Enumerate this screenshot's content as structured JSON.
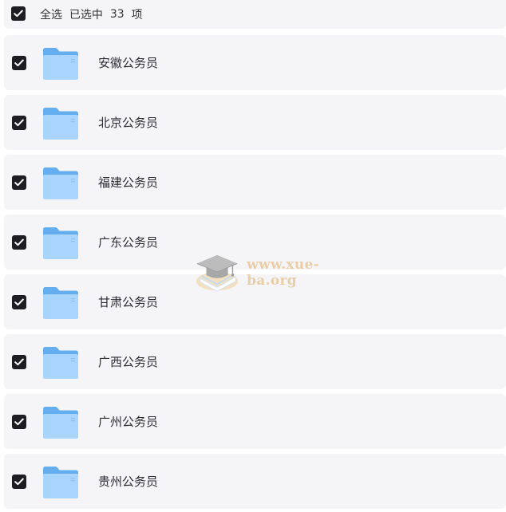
{
  "header": {
    "select_all_label": "全选",
    "selected_prefix": "已选中",
    "selected_count": "33",
    "selected_suffix": "项",
    "checked": true
  },
  "folders": [
    {
      "name": "安徽公务员",
      "checked": true
    },
    {
      "name": "北京公务员",
      "checked": true
    },
    {
      "name": "福建公务员",
      "checked": true
    },
    {
      "name": "广东公务员",
      "checked": true
    },
    {
      "name": "甘肃公务员",
      "checked": true
    },
    {
      "name": "广西公务员",
      "checked": true
    },
    {
      "name": "广州公务员",
      "checked": true
    },
    {
      "name": "贵州公务员",
      "checked": true
    }
  ],
  "watermark": {
    "text": "www.xue-ba.org"
  },
  "colors": {
    "checkbox": "#1e1e22",
    "row_background": "#f5f5f7",
    "folder_blue": "#64aef0",
    "folder_light": "#a9d4fb",
    "watermark_text": "#e8c79a"
  }
}
